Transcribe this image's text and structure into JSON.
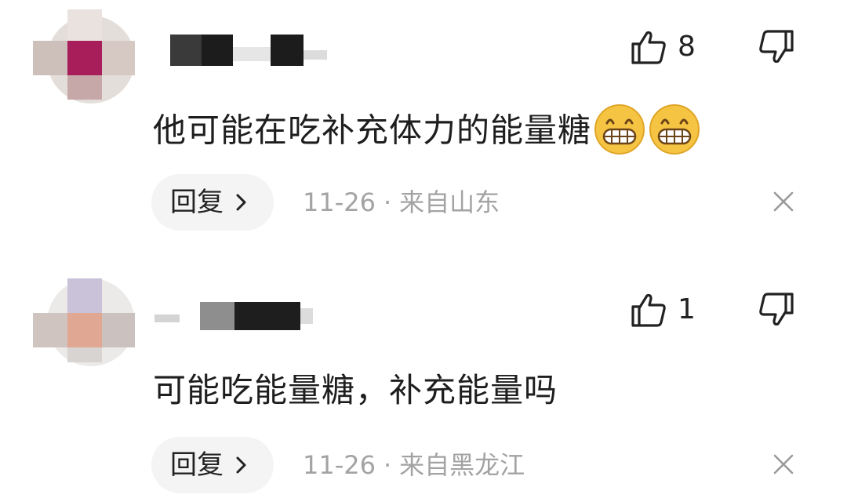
{
  "comments": [
    {
      "likes": "8",
      "text": "他可能在吃补充体力的能量糖",
      "emojis": [
        "grinning-face-icon",
        "grinning-face-icon"
      ],
      "reply_label": "回复",
      "date": "11-26",
      "separator": "·",
      "location": "来自山东"
    },
    {
      "likes": "1",
      "text": "可能吃能量糖，补充能量吗",
      "emojis": [],
      "reply_label": "回复",
      "date": "11-26",
      "separator": "·",
      "location": "来自黑龙江"
    }
  ],
  "colors": {
    "text": "#1e1e1e",
    "meta": "#a3a3a3",
    "reply_bg": "#f4f4f4",
    "emoji_yellow": "#f6c443"
  }
}
